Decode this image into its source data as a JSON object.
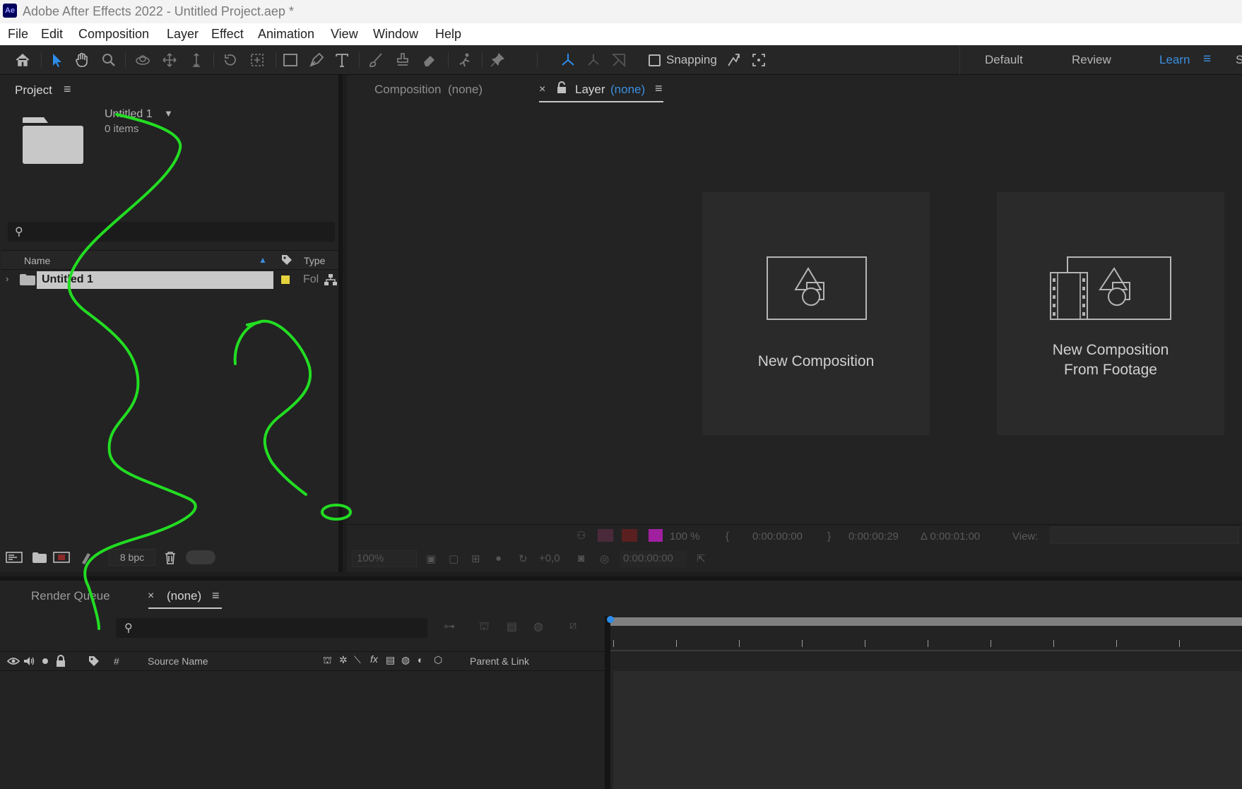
{
  "window": {
    "title": "Adobe After Effects 2022 - Untitled Project.aep *",
    "app_badge": "Ae"
  },
  "menubar": {
    "items": [
      "File",
      "Edit",
      "Composition",
      "Layer",
      "Effect",
      "Animation",
      "View",
      "Window",
      "Help"
    ]
  },
  "toolbar": {
    "snapping_label": "Snapping",
    "workspaces": {
      "default": "Default",
      "review": "Review",
      "learn": "Learn",
      "more": "S"
    },
    "tools": [
      "home-icon",
      "selection-tool-icon",
      "hand-tool-icon",
      "zoom-tool-icon",
      "orbit-camera-icon",
      "pan-camera-icon",
      "dolly-camera-icon",
      "rotation-tool-icon",
      "pan-behind-icon",
      "rectangle-tool-icon",
      "pen-tool-icon",
      "type-tool-icon",
      "brush-tool-icon",
      "clone-stamp-icon",
      "eraser-icon",
      "roto-brush-icon",
      "puppet-pin-icon"
    ]
  },
  "project_panel": {
    "tab_label": "Project",
    "project_name": "Untitled 1",
    "item_count": "0 items",
    "columns": {
      "name": "Name",
      "type": "Type"
    },
    "rows": [
      {
        "name": "Untitled 1",
        "type": "Fol",
        "label_color": "#e5d23c"
      }
    ],
    "bpc": "8 bpc"
  },
  "viewer": {
    "tab_composition": "Composition",
    "tab_composition_value": "(none)",
    "tab_layer": "Layer",
    "tab_layer_value": "(none)",
    "card_new_comp": "New Composition",
    "card_new_comp_footage_line1": "New Composition",
    "card_new_comp_footage_line2": "From Footage",
    "zoom_percent": "100 %",
    "time_in": "0:00:00:00",
    "time_out": "0:00:00:29",
    "duration": "Δ 0:00:01:00",
    "view_label": "View:",
    "magnification": "100%",
    "exposure": "+0,0",
    "current_time": "0:00:00:00"
  },
  "timeline_panel": {
    "tab_render_queue": "Render Queue",
    "tab_comp": "(none)",
    "columns": {
      "hash": "#",
      "source_name": "Source Name",
      "parent_link": "Parent & Link"
    }
  },
  "colors": {
    "accent": "#3b8fe0",
    "annotation": "#22dd22",
    "folder_label": "#e5d23c",
    "label_magenta": "#a020a0",
    "label_red": "#8a2a2a"
  }
}
